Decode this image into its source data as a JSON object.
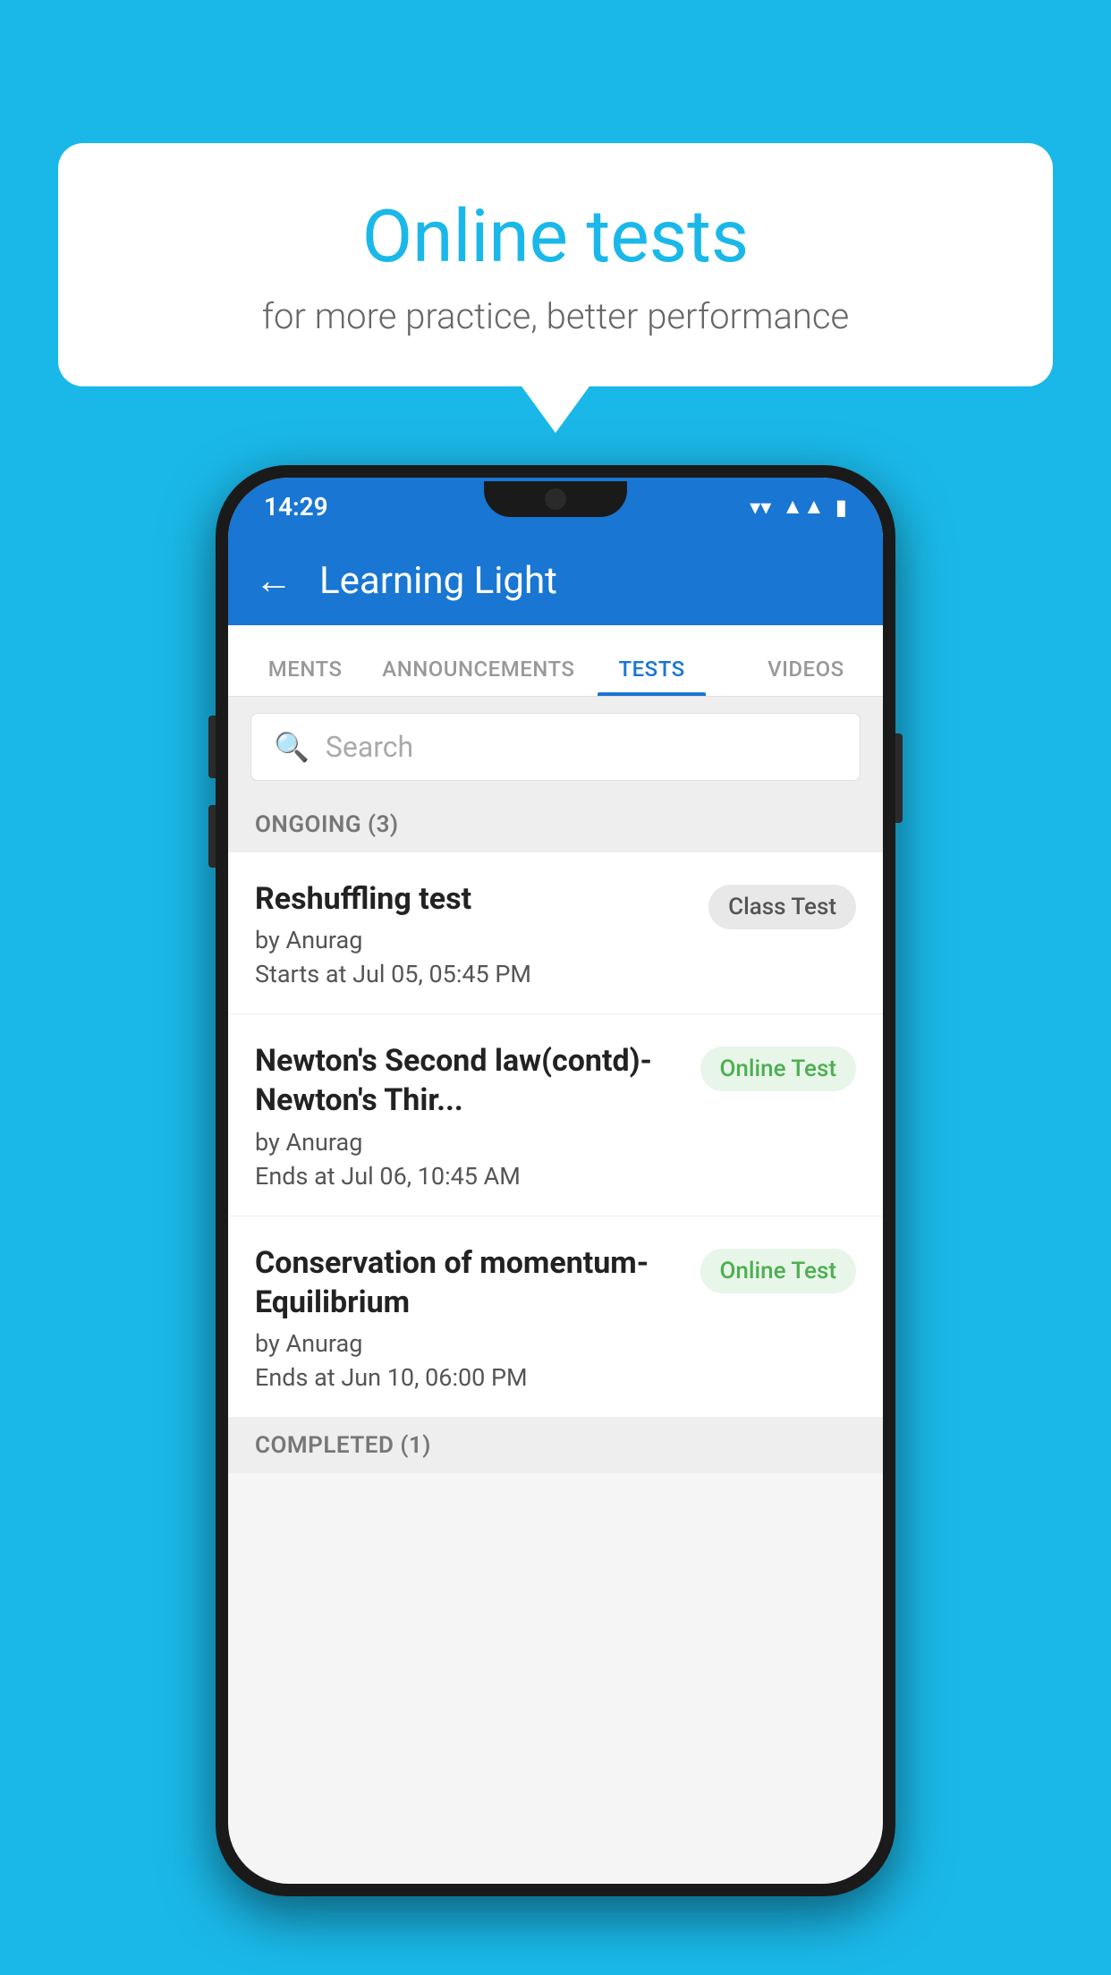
{
  "background_color": "#1ab8e8",
  "speech_bubble": {
    "title": "Online tests",
    "subtitle": "for more practice, better performance"
  },
  "phone": {
    "status_bar": {
      "time": "14:29",
      "icons": [
        "wifi",
        "signal",
        "battery"
      ]
    },
    "app_bar": {
      "title": "Learning Light",
      "back_label": "←"
    },
    "tabs": [
      {
        "label": "MENTS",
        "active": false
      },
      {
        "label": "ANNOUNCEMENTS",
        "active": false
      },
      {
        "label": "TESTS",
        "active": true
      },
      {
        "label": "VIDEOS",
        "active": false
      }
    ],
    "search": {
      "placeholder": "Search"
    },
    "sections": [
      {
        "header": "ONGOING (3)",
        "items": [
          {
            "name": "Reshuffling test",
            "author": "by Anurag",
            "time_label": "Starts at",
            "time_value": "Jul 05, 05:45 PM",
            "badge": "Class Test",
            "badge_type": "class"
          },
          {
            "name": "Newton's Second law(contd)-Newton's Thir...",
            "author": "by Anurag",
            "time_label": "Ends at",
            "time_value": "Jul 06, 10:45 AM",
            "badge": "Online Test",
            "badge_type": "online"
          },
          {
            "name": "Conservation of momentum-Equilibrium",
            "author": "by Anurag",
            "time_label": "Ends at",
            "time_value": "Jun 10, 06:00 PM",
            "badge": "Online Test",
            "badge_type": "online"
          }
        ]
      },
      {
        "header": "COMPLETED (1)",
        "items": []
      }
    ]
  }
}
